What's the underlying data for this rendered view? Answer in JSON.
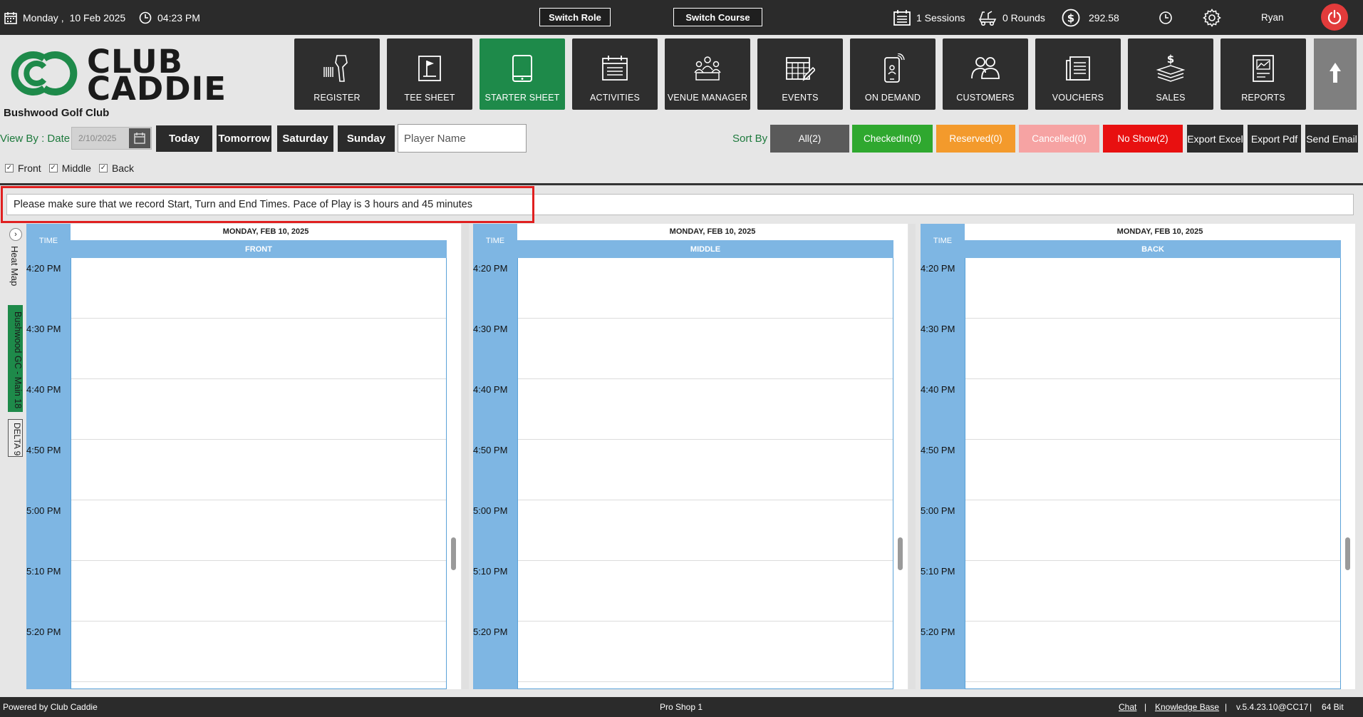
{
  "topbar": {
    "day": "Monday ,",
    "date": "10 Feb 2025",
    "time": "04:23 PM",
    "switch_role": "Switch Role",
    "switch_course": "Switch Course",
    "sessions": "1 Sessions",
    "rounds": "0 Rounds",
    "balance": "292.58",
    "user": "Ryan"
  },
  "logo": {
    "line1": "CLUB",
    "line2": "CADDIE",
    "club_name": "Bushwood Golf Club",
    "brand_color": "#1e8a4a"
  },
  "nav": [
    {
      "label": "REGISTER",
      "icon": "barcode-scanner-icon"
    },
    {
      "label": "TEE SHEET",
      "icon": "tee-sheet-flag-icon"
    },
    {
      "label": "STARTER SHEET",
      "icon": "tablet-icon",
      "active": true
    },
    {
      "label": "ACTIVITIES",
      "icon": "calendar-list-icon"
    },
    {
      "label": "VENUE MANAGER",
      "icon": "venue-people-icon"
    },
    {
      "label": "EVENTS",
      "icon": "calendar-edit-icon"
    },
    {
      "label": "ON DEMAND",
      "icon": "mobile-phone-icon"
    },
    {
      "label": "CUSTOMERS",
      "icon": "customers-icon"
    },
    {
      "label": "VOUCHERS",
      "icon": "voucher-icon"
    },
    {
      "label": "SALES",
      "icon": "cash-stack-icon"
    },
    {
      "label": "REPORTS",
      "icon": "report-chart-icon"
    }
  ],
  "filters": {
    "view_by": "View By : Date",
    "date_value": "2/10/2025",
    "today": "Today",
    "tomorrow": "Tomorrow",
    "saturday": "Saturday",
    "sunday": "Sunday",
    "player_placeholder": "Player Name",
    "sort_by": "Sort By",
    "all": "All(2)",
    "checked_in": "CheckedIn(0)",
    "reserved": "Reserved(0)",
    "cancelled": "Cancelled(0)",
    "no_show": "No Show(2)",
    "export_excel": "Export Excel",
    "export_pdf": "Export Pdf",
    "send_email": "Send Email",
    "colors": {
      "all": "#5a5a5a",
      "checked_in": "#2fa82f",
      "reserved": "#f39a2c",
      "cancelled": "#f6a3a3",
      "no_show": "#e81010"
    }
  },
  "checks": {
    "front": "Front",
    "middle": "Middle",
    "back": "Back"
  },
  "notice": "Please make sure that we record Start, Turn and End Times. Pace of Play is 3 hours and 45 minutes",
  "side_tabs": {
    "heat_map": "Heat Map",
    "course": "Bushwood GC - Main 18",
    "delta": "DELTA 9"
  },
  "panels": [
    {
      "date": "MONDAY, FEB 10, 2025",
      "section": "FRONT",
      "time_head": "TIME"
    },
    {
      "date": "MONDAY, FEB 10, 2025",
      "section": "MIDDLE",
      "time_head": "TIME"
    },
    {
      "date": "MONDAY, FEB 10, 2025",
      "section": "BACK",
      "time_head": "TIME"
    }
  ],
  "times": [
    "4:20 PM",
    "4:30 PM",
    "4:40 PM",
    "4:50 PM",
    "5:00 PM",
    "5:10 PM",
    "5:20 PM"
  ],
  "footer": {
    "powered": "Powered by Club Caddie",
    "location": "Pro Shop 1",
    "chat": "Chat",
    "sep": "|",
    "kb": "Knowledge Base",
    "version": "v.5.4.23.10@CC17",
    "bits": "64 Bit"
  }
}
